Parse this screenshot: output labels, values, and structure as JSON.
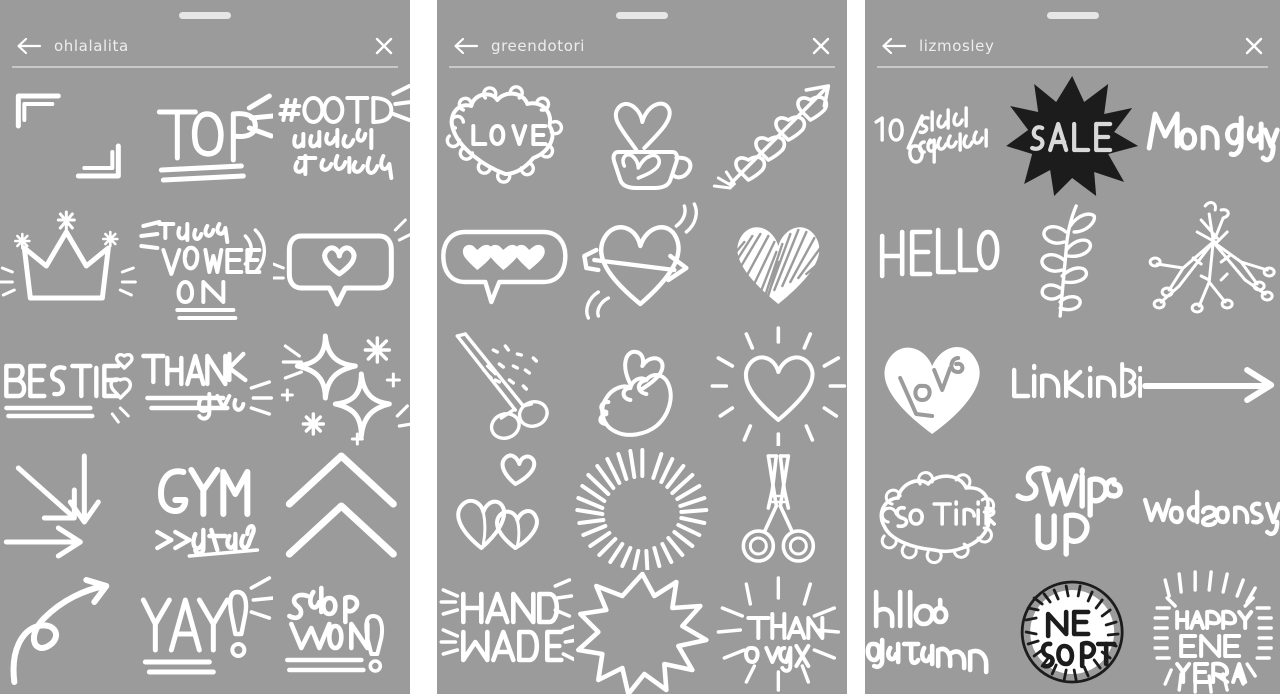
{
  "app": {
    "name": "instagram-story-sticker-picker",
    "background_color": "#9b9b9b",
    "sticker_color": "#ffffff",
    "accent_dark": "#1c1c1c"
  },
  "panels": [
    {
      "id": "panel-ohlalalita",
      "handle_label": "drag-handle",
      "back_label": "Back",
      "username": "ohlalalita",
      "close_label": "Close",
      "stickers": [
        {
          "name": "corner-frame-brackets",
          "text": ""
        },
        {
          "name": "top-text",
          "text": "TOP"
        },
        {
          "name": "ootd-outfit-of-the-day-text",
          "text": "#OOTD outfit of the day"
        },
        {
          "name": "sparkling-crown",
          "text": ""
        },
        {
          "name": "turn-volume-on-text",
          "text": "turn VOLUME ON"
        },
        {
          "name": "heart-speech-bubble",
          "text": ""
        },
        {
          "name": "bestie-hearts-text",
          "text": "BESTIE"
        },
        {
          "name": "thank-you-text",
          "text": "THANK you"
        },
        {
          "name": "sparkles-cluster",
          "text": ""
        },
        {
          "name": "converging-arrows",
          "text": ""
        },
        {
          "name": "gym-time-text",
          "text": "GYM >> time"
        },
        {
          "name": "double-up-chevrons",
          "text": ""
        },
        {
          "name": "curly-loop-arrow",
          "text": ""
        },
        {
          "name": "yay-text",
          "text": "YAY!"
        },
        {
          "name": "shop-now-text",
          "text": "shop NOW!"
        }
      ]
    },
    {
      "id": "panel-greendotori",
      "handle_label": "drag-handle",
      "back_label": "Back",
      "username": "greendotori",
      "close_label": "Close",
      "stickers": [
        {
          "name": "cloud-heart-love-text",
          "text": "LOVE"
        },
        {
          "name": "coffee-cup-heart-steam",
          "text": ""
        },
        {
          "name": "hearts-trail-arrow",
          "text": ""
        },
        {
          "name": "three-hearts-speech-bubble",
          "text": ""
        },
        {
          "name": "heart-with-arrow",
          "text": ""
        },
        {
          "name": "scribbled-heart",
          "text": ""
        },
        {
          "name": "scissors-with-confetti",
          "text": ""
        },
        {
          "name": "finger-heart-hand",
          "text": ""
        },
        {
          "name": "radiating-heart",
          "text": ""
        },
        {
          "name": "three-small-hearts",
          "text": ""
        },
        {
          "name": "sunburst-circle",
          "text": ""
        },
        {
          "name": "upright-scissors",
          "text": ""
        },
        {
          "name": "hand-made-text",
          "text": "HAND MADE"
        },
        {
          "name": "starburst-outline",
          "text": ""
        },
        {
          "name": "thank-you-rays-text",
          "text": "Thank you"
        }
      ]
    },
    {
      "id": "panel-lizmosley",
      "handle_label": "drag-handle",
      "back_label": "Back",
      "username": "lizmosley",
      "close_label": "Close",
      "stickers": [
        {
          "name": "ten-out-of-ten-would-recommend-text",
          "text": "10/10 would recommend"
        },
        {
          "name": "sale-starburst-badge",
          "text": "SALE"
        },
        {
          "name": "monday-text",
          "text": "Monday"
        },
        {
          "name": "hello-text",
          "text": "HELLO"
        },
        {
          "name": "leafy-sprig",
          "text": ""
        },
        {
          "name": "floral-bouquet",
          "text": ""
        },
        {
          "name": "filled-heart-love-text",
          "text": "Love"
        },
        {
          "name": "link-in-bio-text",
          "text": "Link in Bio"
        },
        {
          "name": "long-right-arrow",
          "text": ""
        },
        {
          "name": "so-tired-cloud-text",
          "text": "so tired"
        },
        {
          "name": "swipe-up-text",
          "text": "Swipe Up"
        },
        {
          "name": "wednesday-text",
          "text": "wednesday"
        },
        {
          "name": "hello-autumn-text",
          "text": "hello autumn"
        },
        {
          "name": "new-post-wreath-badge",
          "text": "NEW POST"
        },
        {
          "name": "happy-new-year-rays-text",
          "text": "HAPPY NEW YEAR"
        }
      ]
    }
  ]
}
